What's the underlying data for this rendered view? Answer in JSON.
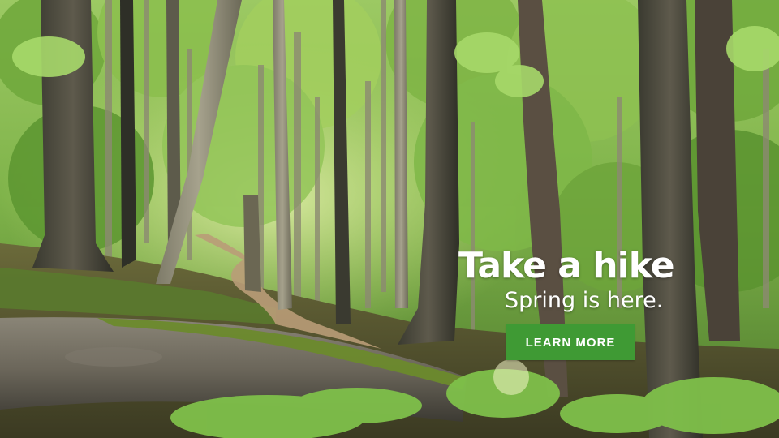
{
  "hero": {
    "headline": "Take a hike",
    "subheadline": "Spring is here.",
    "cta_label": "LEARN MORE",
    "cta_color": "#3f9a34",
    "image_subject": "forest-trail"
  }
}
